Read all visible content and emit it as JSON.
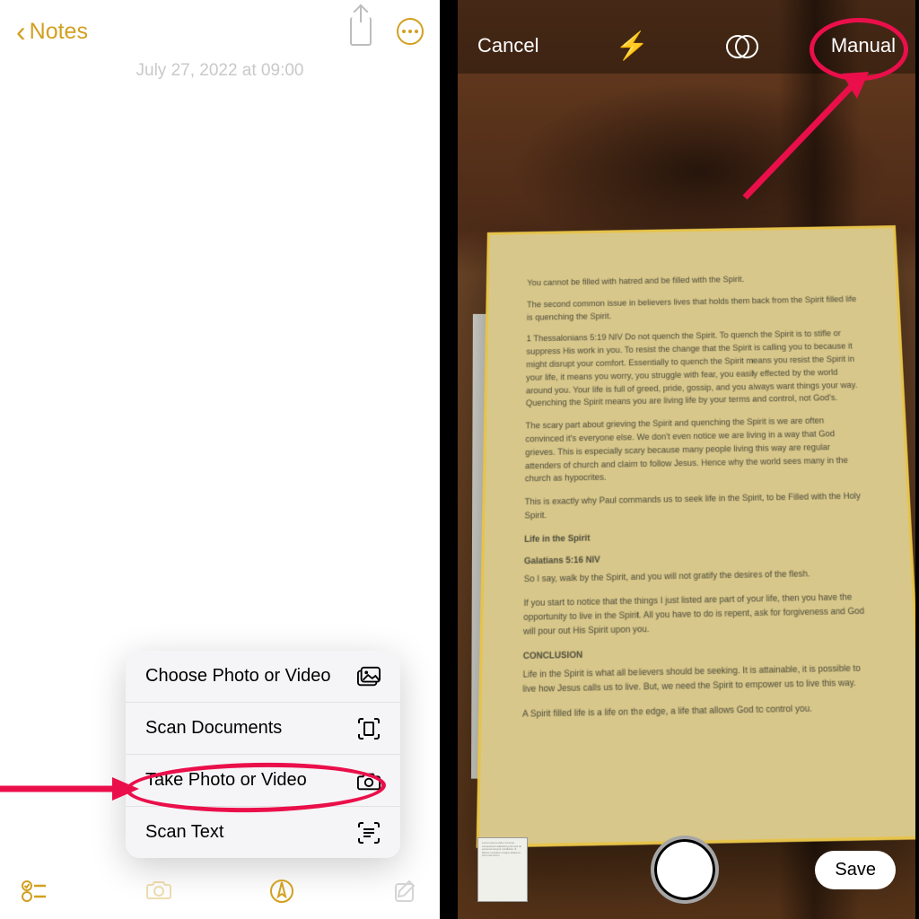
{
  "left": {
    "back_label": "Notes",
    "date_text": "July 27, 2022 at 09:00",
    "popup": {
      "choose": "Choose Photo or Video",
      "scan_docs": "Scan Documents",
      "take_photo": "Take Photo or Video",
      "scan_text": "Scan Text"
    }
  },
  "right": {
    "cancel": "Cancel",
    "mode": "Manual",
    "save": "Save",
    "document": {
      "p1": "You cannot be filled with hatred and be filled with the Spirit.",
      "p2": "The second common issue in believers lives that holds them back from the Spirit filled life is quenching the Spirit.",
      "p3": "1 Thessalonians 5:19 NIV Do not quench the Spirit. To quench the Spirit is to stifle or suppress His work in you. To resist the change that the Spirit is calling you to because it might disrupt your comfort. Essentially to quench the Spirit means you resist the Spirit in your life, it means you worry, you struggle with fear, you easily effected by the world around you. Your life is full of greed, pride, gossip, and you always want things your way. Quenching the Spirit means you are living life by your terms and control, not God's.",
      "p4": "The scary part about grieving the Spirit and quenching the Spirit is we are often convinced it's everyone else. We don't even notice we are living in a way that God grieves. This is especially scary because many people living this way are regular attenders of church and claim to follow Jesus. Hence why the world sees many in the church as hypocrites.",
      "p5": "This is exactly why Paul commands us to seek life in the Spirit, to be Filled with the Holy Spirit.",
      "h1": "Life in the Spirit",
      "h2": "Galatians 5:16 NIV",
      "p6": "So I say, walk by the Spirit, and you will not gratify the desires of the flesh.",
      "p7": "If you start to notice that the things I just listed are part of your life, then you have the opportunity to live in the Spirit. All you have to do is repent, ask for forgiveness and God will pour out His Spirit upon you.",
      "h3": "CONCLUSION",
      "p8": "Life in the Spirit is what all believers should be seeking. It is attainable, it is possible to live how Jesus calls us to live. But, we need the Spirit to empower us to live this way.",
      "p9": "A Spirit filled life is a life on the edge, a life that allows God to control you."
    }
  }
}
